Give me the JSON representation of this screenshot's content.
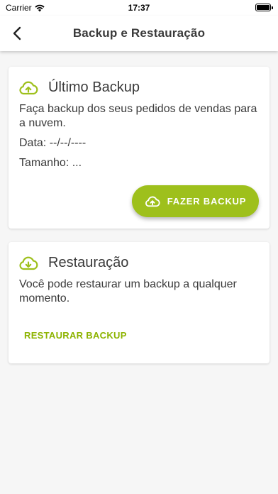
{
  "status_bar": {
    "carrier": "Carrier",
    "time": "17:37"
  },
  "app_bar": {
    "title": "Backup e Restauração"
  },
  "backup_card": {
    "title": "Último Backup",
    "description": "Faça backup dos seus pedidos de vendas para a nuvem.",
    "date_line": "Data: --/--/----",
    "size_line": "Tamanho: ...",
    "button_label": "FAZER BACKUP"
  },
  "restore_card": {
    "title": "Restauração",
    "description": "Você pode restaurar um backup a qualquer momento.",
    "button_label": "RESTAURAR BACKUP"
  },
  "colors": {
    "accent": "#9ec01c",
    "accent_text": "#8db300",
    "background": "#f6f6f6"
  },
  "icons": {
    "back": "chevron-left-icon",
    "upload": "cloud-upload-icon",
    "download": "cloud-download-icon"
  }
}
